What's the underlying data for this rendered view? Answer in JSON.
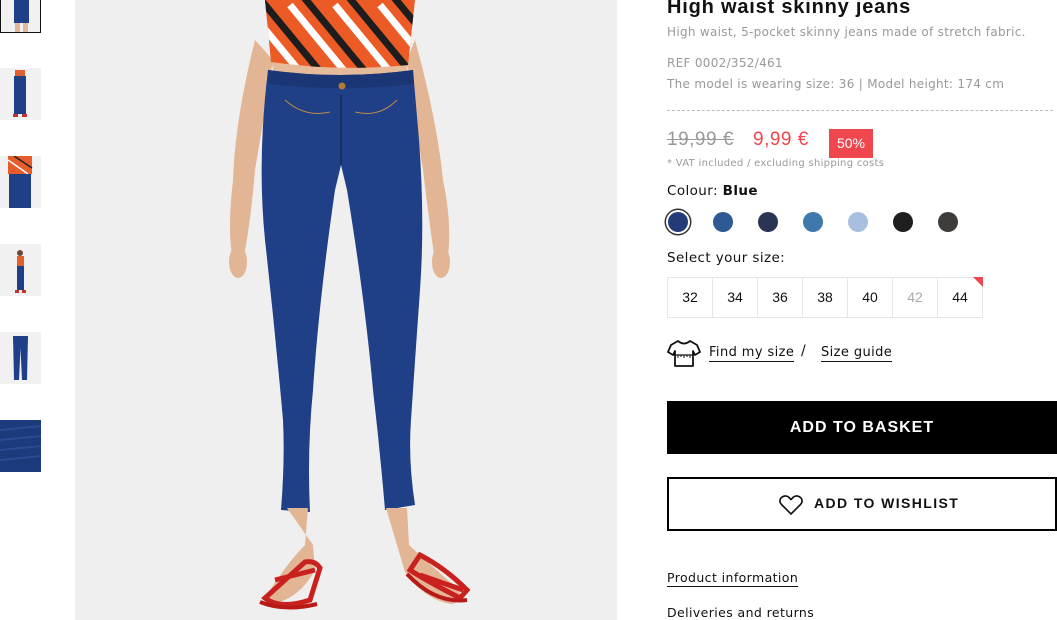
{
  "product": {
    "title": "High waist skinny jeans",
    "description": "High waist, 5-pocket skinny jeans made of stretch fabric.",
    "ref": "REF 0002/352/461",
    "model_info": "The model is wearing size: 36 | Model height: 174 cm"
  },
  "price": {
    "old": "19,99 €",
    "new": "9,99 €",
    "discount": "50%",
    "vat_note": "* VAT included / excluding shipping costs"
  },
  "colour": {
    "label": "Colour:",
    "selected": "Blue",
    "swatches": [
      {
        "name": "blue",
        "color": "#243b7a",
        "selected": true
      },
      {
        "name": "mid-blue",
        "color": "#2d5a93"
      },
      {
        "name": "navy",
        "color": "#2a3553"
      },
      {
        "name": "light-blue",
        "color": "#3f78ab"
      },
      {
        "name": "bleached",
        "color": "#a9bfdf"
      },
      {
        "name": "black",
        "color": "#1e1e1e"
      },
      {
        "name": "grey-black",
        "color": "#3f3d3b"
      }
    ]
  },
  "sizes": {
    "label": "Select your size:",
    "options": [
      "32",
      "34",
      "36",
      "38",
      "40",
      "42",
      "44"
    ],
    "unavailable": [
      "42"
    ],
    "last_units": [
      "44"
    ]
  },
  "fit": {
    "find_my_size": "Find my size",
    "separator": "/",
    "size_guide": "Size guide"
  },
  "actions": {
    "add_to_basket": "ADD TO BASKET",
    "add_to_wishlist": "ADD TO WISHLIST"
  },
  "links": {
    "product_information": "Product information",
    "deliveries_returns": "Deliveries and returns"
  },
  "colors": {
    "accent": "#f0474f",
    "primary": "#000000",
    "muted_text": "#999999",
    "image_bg": "#efefef"
  }
}
